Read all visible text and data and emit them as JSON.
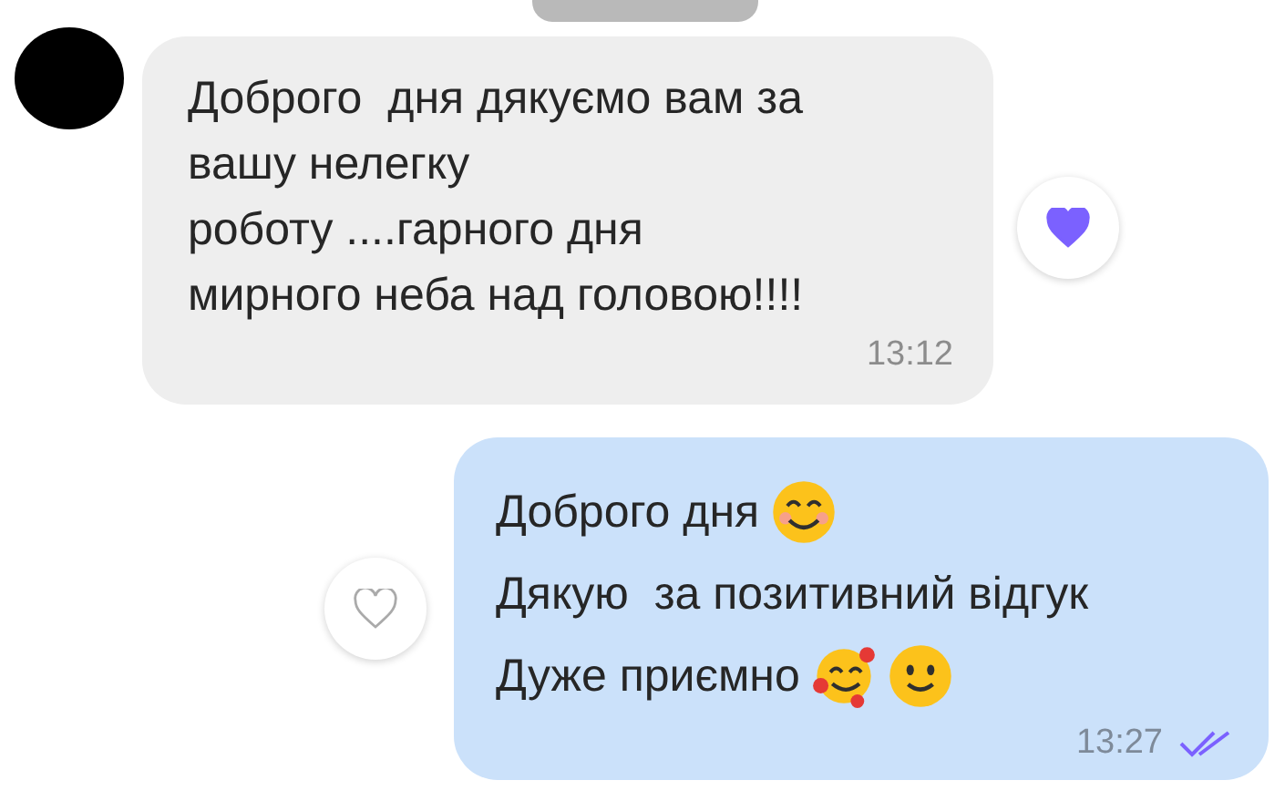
{
  "messages": [
    {
      "kind": "incoming",
      "text": "Доброго  дня дякуємо вам за\nвашу нелегку\nроботу ....гарного дня\nмирного неба над головою!!!!",
      "time": "13:12",
      "liked": true
    },
    {
      "kind": "outgoing",
      "lines": [
        {
          "text": "Доброго дня",
          "emojis": [
            {
              "kind": "smiling"
            }
          ]
        },
        {
          "text": "Дякую  за позитивний відгук"
        },
        {
          "text": "Дуже приємно",
          "emojis": [
            {
              "kind": "hearts"
            },
            {
              "kind": "slight"
            }
          ]
        }
      ],
      "time": "13:27",
      "liked": false,
      "read": true
    }
  ]
}
